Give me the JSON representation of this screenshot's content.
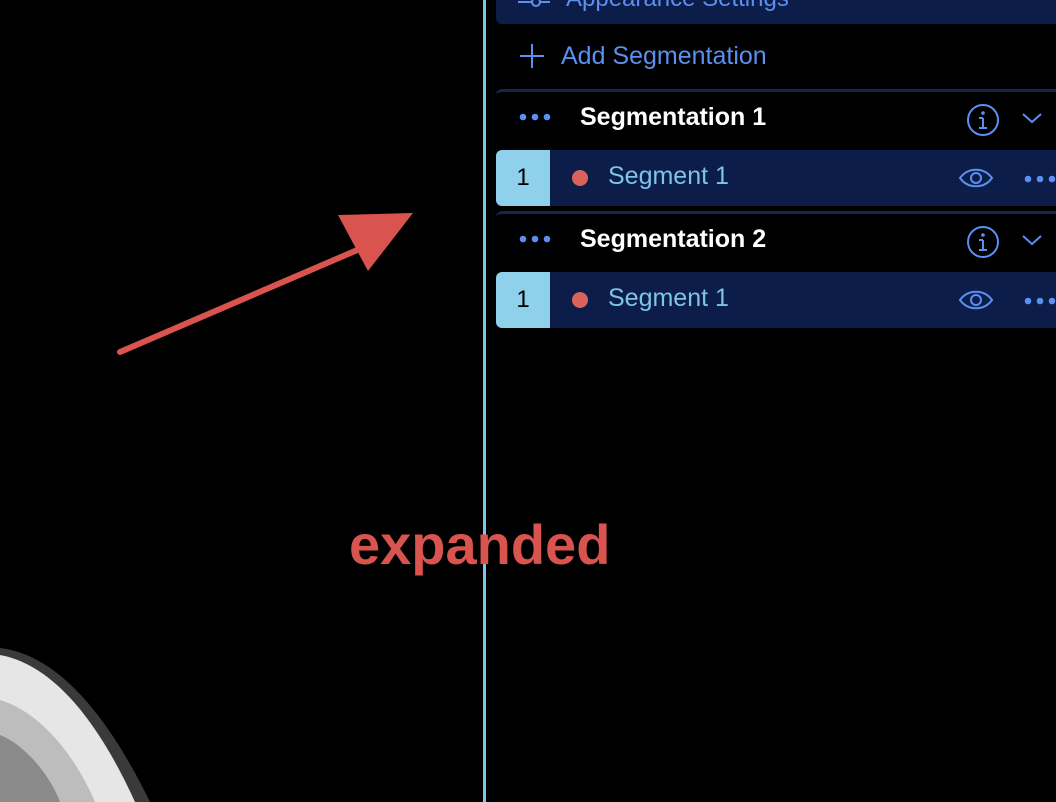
{
  "panel": {
    "appearance_settings_label": "Appearance Settings",
    "add_segmentation_label": "Add Segmentation",
    "segmentations": [
      {
        "title": "Segmentation 1",
        "segments": [
          {
            "index": "1",
            "label": "Segment 1",
            "color": "#d9625c"
          }
        ]
      },
      {
        "title": "Segmentation 2",
        "segments": [
          {
            "index": "1",
            "label": "Segment 1",
            "color": "#d9625c"
          }
        ]
      }
    ]
  },
  "annotation": {
    "text": "expanded",
    "color": "#d9534f"
  },
  "colors": {
    "accent": "#5b8ff0",
    "row_bg": "#0c1d4a",
    "index_bg": "#8fd0eb",
    "divider": "#7cc4e8"
  }
}
